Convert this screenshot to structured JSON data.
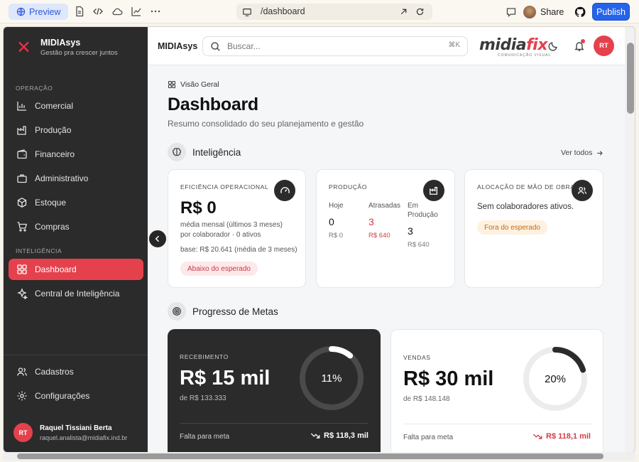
{
  "browser": {
    "preview_label": "Preview",
    "url": "/dashboard",
    "share_label": "Share",
    "publish_label": "Publish"
  },
  "sidebar": {
    "brand_name": "MIDIAsys",
    "brand_tagline": "Gestão pra crescer juntos",
    "section_operacao": "OPERAÇÃO",
    "section_inteligencia": "INTELIGÊNCIA",
    "items": [
      {
        "label": "Comercial",
        "icon": "chart-bar-icon"
      },
      {
        "label": "Produção",
        "icon": "factory-icon"
      },
      {
        "label": "Financeiro",
        "icon": "wallet-icon"
      },
      {
        "label": "Administrativo",
        "icon": "briefcase-icon"
      },
      {
        "label": "Estoque",
        "icon": "package-icon"
      },
      {
        "label": "Compras",
        "icon": "cart-icon"
      },
      {
        "label": "Dashboard",
        "icon": "grid-icon",
        "active": true
      },
      {
        "label": "Central de Inteligência",
        "icon": "sparkles-icon"
      },
      {
        "label": "Cadastros",
        "icon": "users-icon"
      },
      {
        "label": "Configurações",
        "icon": "gear-icon"
      }
    ],
    "user_initials": "RT",
    "user_name": "Raquel Tissiani Berta",
    "user_email": "raquel.analista@midiafix.ind.br"
  },
  "header": {
    "title": "MIDIAsys",
    "search_placeholder": "Buscar...",
    "search_shortcut": "⌘K",
    "logo_main": "midia",
    "logo_accent": "fix",
    "logo_sub": "COMUNICAÇÃO VISUAL",
    "avatar_initials": "RT"
  },
  "main": {
    "breadcrumb": "Visão Geral",
    "title": "Dashboard",
    "subtitle": "Resumo consolidado do seu planejamento e gestão",
    "section_inteligencia": "Inteligência",
    "see_all": "Ver todos",
    "section_metas": "Progresso de Metas"
  },
  "cards": {
    "eficiencia": {
      "label": "EFICIÊNCIA OPERACIONAL",
      "value": "R$ 0",
      "line1": "média mensal (últimos 3 meses)",
      "line2": "por colaborador · 0 ativos",
      "line3": "base: R$ 20.641 (média de 3 meses)",
      "badge": "Abaixo do esperado"
    },
    "producao": {
      "label": "PRODUÇÃO",
      "cols": [
        {
          "label": "Hoje",
          "value": "0",
          "amount": "R$ 0"
        },
        {
          "label": "Atrasadas",
          "value": "3",
          "amount": "R$ 640"
        },
        {
          "label": "Em Produção",
          "value": "3",
          "amount": "R$ 640"
        }
      ]
    },
    "alocacao": {
      "label": "ALOCAÇÃO DE MÃO DE OBRA",
      "text": "Sem colaboradores ativos.",
      "badge": "Fora do esperado"
    }
  },
  "goals": [
    {
      "label": "RECEBIMENTO",
      "value": "R$ 15 mil",
      "sub": "de R$ 133.333",
      "percent_text": "11%",
      "progress": 0.11,
      "foot_label": "Falta para meta",
      "foot_value": "R$ 118,3 mil"
    },
    {
      "label": "VENDAS",
      "value": "R$ 30 mil",
      "sub": "de R$ 148.148",
      "percent_text": "20%",
      "progress": 0.2,
      "foot_label": "Falta para meta",
      "foot_value": "R$ 118,1 mil"
    }
  ],
  "colors": {
    "accent": "#e5414d",
    "dark": "#2b2b2b",
    "publish": "#2563eb"
  }
}
